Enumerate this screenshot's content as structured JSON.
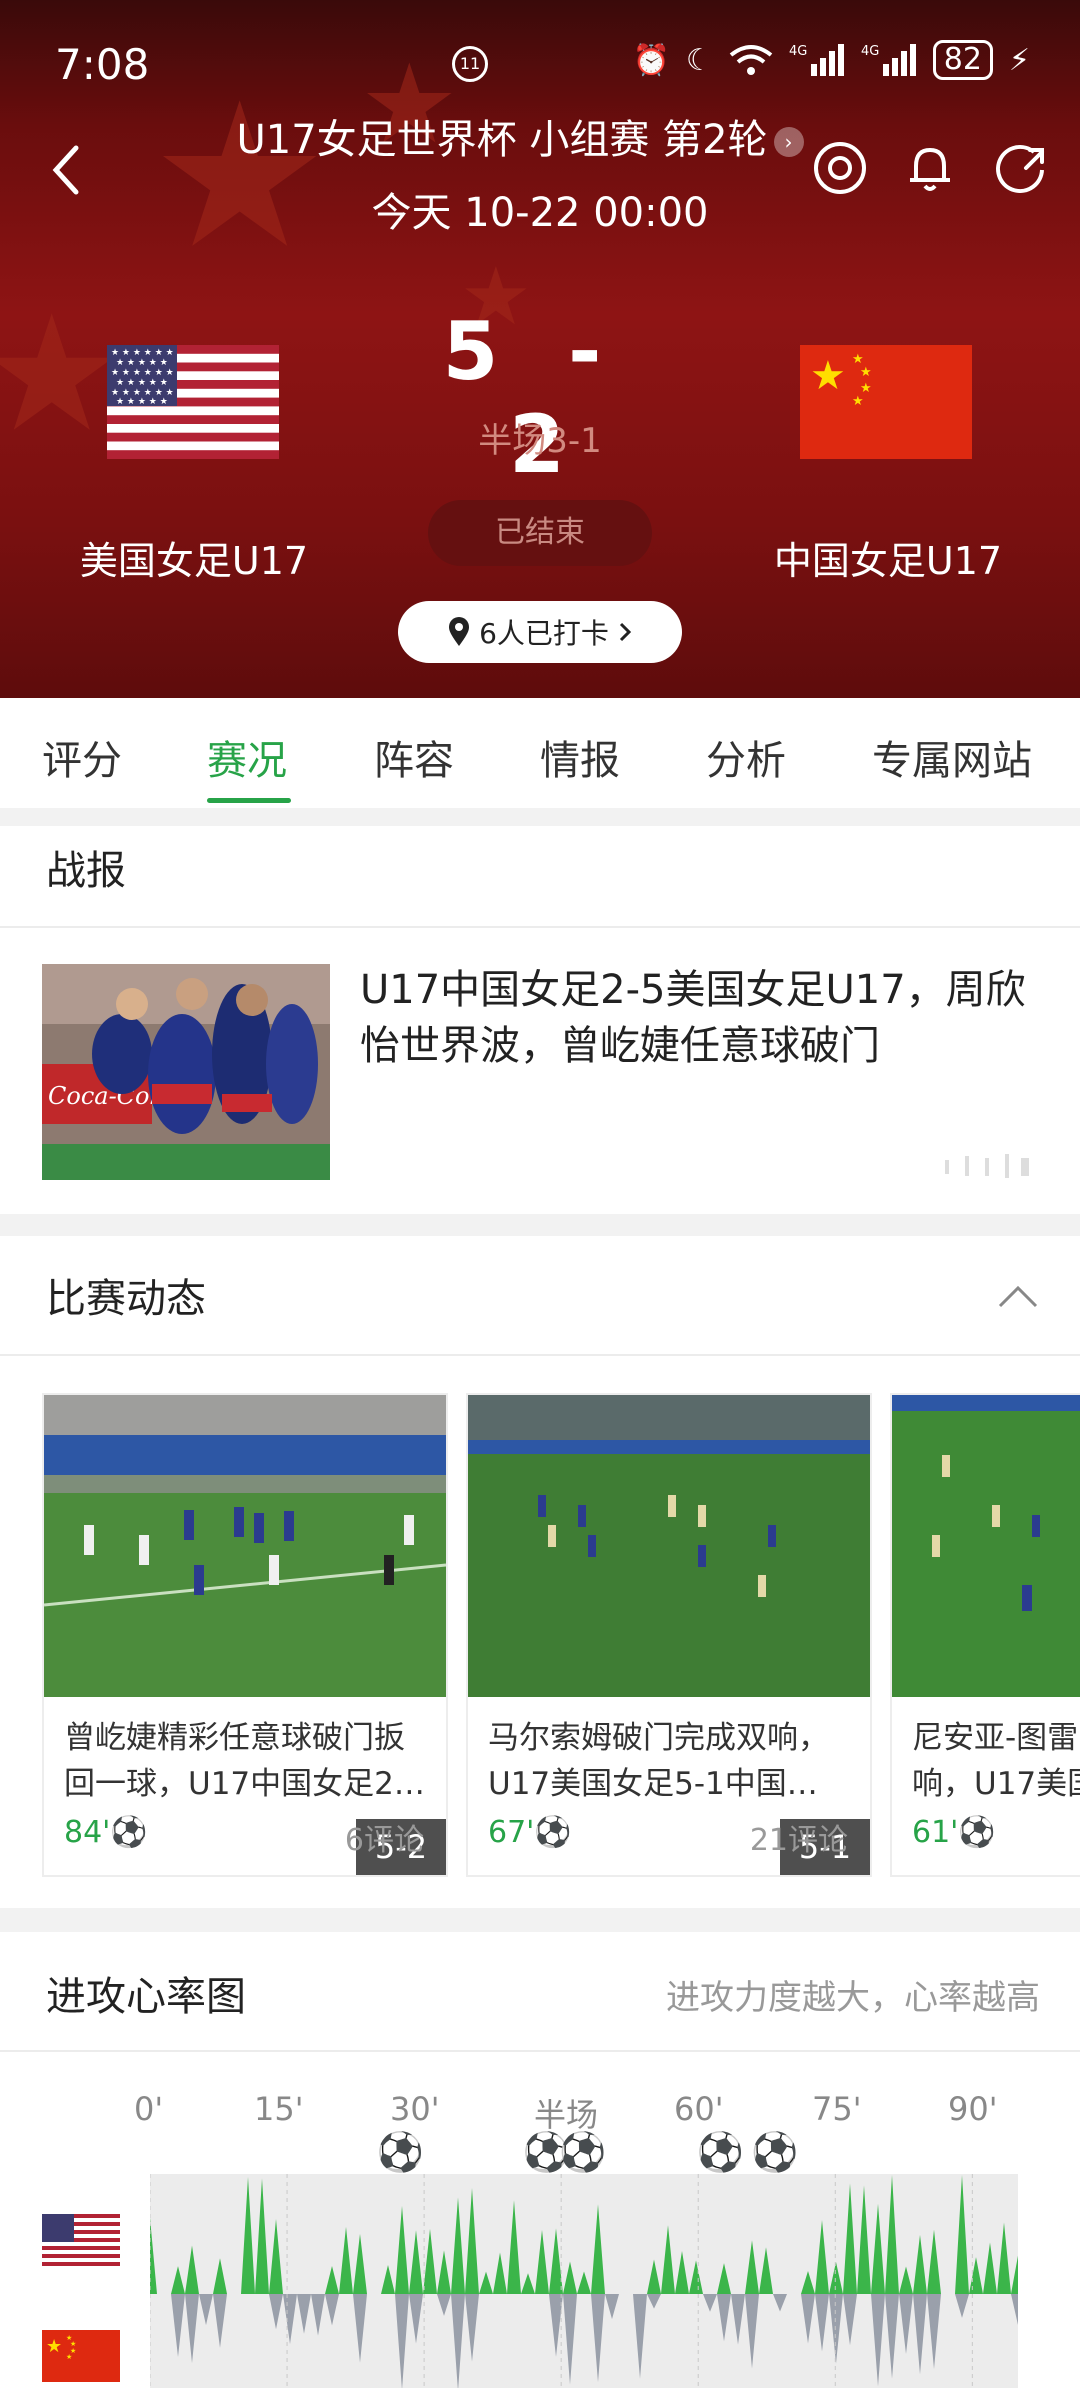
{
  "status_bar": {
    "time": "7:08",
    "center_icon": "11",
    "battery": "82"
  },
  "header": {
    "title": "U17女足世界杯 小组赛 第2轮",
    "datetime": "今天 10-22 00:00"
  },
  "match": {
    "home_team": "美国女足U17",
    "away_team": "中国女足U17",
    "home_score": "5",
    "away_score": "2",
    "separator": "-",
    "halftime": "半场3-1",
    "status": "已结束",
    "checkin": "6人已打卡"
  },
  "tabs": [
    "评分",
    "赛况",
    "阵容",
    "情报",
    "分析",
    "专属网站"
  ],
  "active_tab": "赛况",
  "battle_report": {
    "section_title": "战报",
    "headline": "U17中国女足2-5美国女足U17，周欣怡世界波，曾屹婕任意球破门"
  },
  "match_events": {
    "section_title": "比赛动态",
    "items": [
      {
        "score": "5-2",
        "title": "曾屹婕精彩任意球破门扳回一球，U17中国女足2…",
        "minute": "84'",
        "comments": "6评论"
      },
      {
        "score": "5-1",
        "title": "马尔索姆破门完成双响，U17美国女足5-1中国…",
        "minute": "67'",
        "comments": "21评论"
      },
      {
        "score": "",
        "title": "尼安亚-图雷响，U17美国",
        "minute": "61'",
        "comments": ""
      }
    ]
  },
  "heart_rate": {
    "section_title": "进攻心率图",
    "subtitle": "进攻力度越大，心率越高",
    "axis_labels": [
      "0'",
      "15'",
      "30'",
      "半场",
      "60'",
      "75'",
      "90'"
    ],
    "goal_minutes": [
      27,
      43,
      47,
      62,
      68
    ],
    "home_color": "#3bb54a",
    "away_color": "#9aa0ab"
  },
  "colors": {
    "accent": "#27a348",
    "hero_red": "#8e1414"
  }
}
